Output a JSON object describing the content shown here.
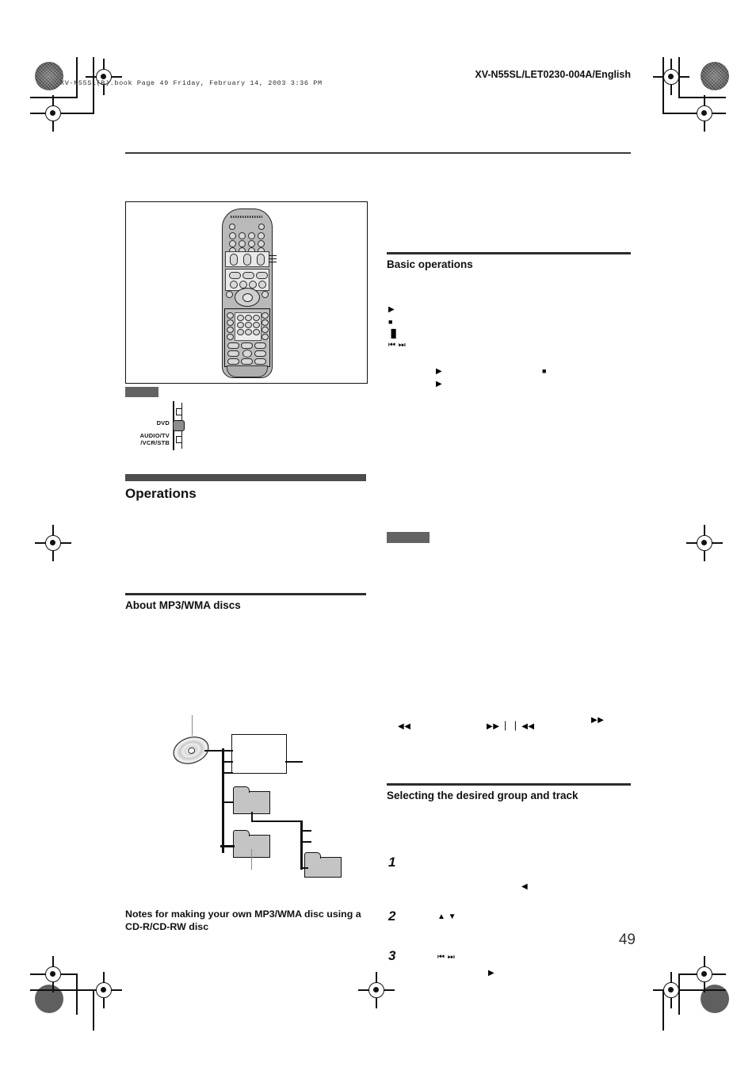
{
  "document": {
    "book_line": "XV-N55SL(B).book  Page 49  Friday, February 14, 2003  3:36 PM",
    "doc_id": "XV-N55SL/LET0230-004A/English",
    "page_number": "49"
  },
  "remote": {
    "caption_block": "",
    "selector": {
      "label_top": "DVD",
      "label_bottom_line1": "AUDIO/TV",
      "label_bottom_line2": "/VCR/STB"
    }
  },
  "left_column": {
    "section_heading": "Operations",
    "subsection_heading": "About MP3/WMA discs",
    "notes_heading_line1": "Notes for making your own MP3/WMA disc using a",
    "notes_heading_line2": "CD-R/CD-RW disc",
    "tree_diagram": {
      "type": "hierarchy",
      "root": "disc",
      "nodes": [
        "root-box",
        "folder-1",
        "folder-2",
        "folder-3"
      ]
    }
  },
  "right_column": {
    "basic_operations_heading": "Basic operations",
    "basic_symbols": [
      {
        "name": "play",
        "glyph": "▶"
      },
      {
        "name": "stop",
        "glyph": "■"
      },
      {
        "name": "pause",
        "glyph": "▐▌"
      },
      {
        "name": "skip",
        "glyph": "⏮ ⏭"
      }
    ],
    "inline_symbols": [
      {
        "name": "play",
        "glyph": "▶"
      },
      {
        "name": "stop",
        "glyph": "■"
      },
      {
        "name": "play",
        "glyph": "▶"
      }
    ],
    "search_symbols": [
      {
        "name": "rewind",
        "glyph": "◀◀"
      },
      {
        "name": "skip-forward",
        "glyph": "▶▶▕"
      },
      {
        "name": "skip-back",
        "glyph": "▏◀◀"
      },
      {
        "name": "fast-forward",
        "glyph": "▶▶"
      }
    ],
    "selecting_heading": "Selecting the desired group and track",
    "steps": [
      {
        "number": "1",
        "glyph": "◀",
        "glyph_name": "cursor-left"
      },
      {
        "number": "2",
        "glyph": "▲ ▼",
        "glyph_name": "cursor-up-down"
      },
      {
        "number": "3",
        "glyph": "⏮ ⏭",
        "glyph_name": "skip-back-forward",
        "glyph2": "▶",
        "glyph2_name": "play"
      }
    ]
  },
  "colors": {
    "heading_bar": "#4d4d4d",
    "rule": "#2d2d2d",
    "redaction": "#636363",
    "folder_fill": "#c4c4c4"
  }
}
